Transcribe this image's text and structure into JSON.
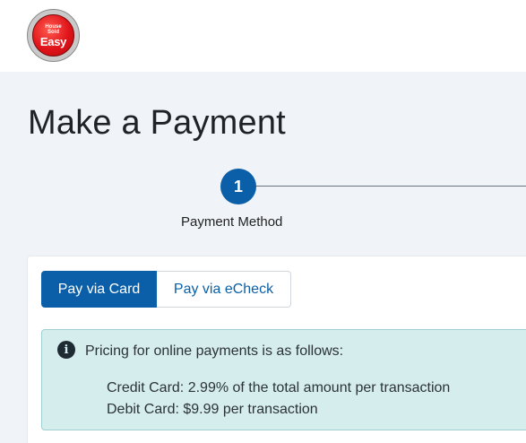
{
  "brand": {
    "logo_top": "House",
    "logo_middle": "Sold",
    "logo_bottom": "Easy"
  },
  "page": {
    "title": "Make a Payment"
  },
  "stepper": {
    "steps": [
      {
        "number": "1",
        "label": "Payment Method",
        "active": true
      }
    ]
  },
  "payment_tabs": {
    "card_label": "Pay via Card",
    "echeck_label": "Pay via eCheck",
    "selected": "Pay via Card"
  },
  "pricing_alert": {
    "icon": "info-icon",
    "heading": "Pricing for online payments is as follows:",
    "lines": [
      "Credit Card: 2.99% of the total amount per transaction",
      "Debit Card: $9.99 per transaction"
    ]
  },
  "colors": {
    "primary": "#0b5fa8",
    "page_background": "#f0f4f8",
    "alert_background": "#d6eded",
    "logo_red": "#e0141a"
  }
}
